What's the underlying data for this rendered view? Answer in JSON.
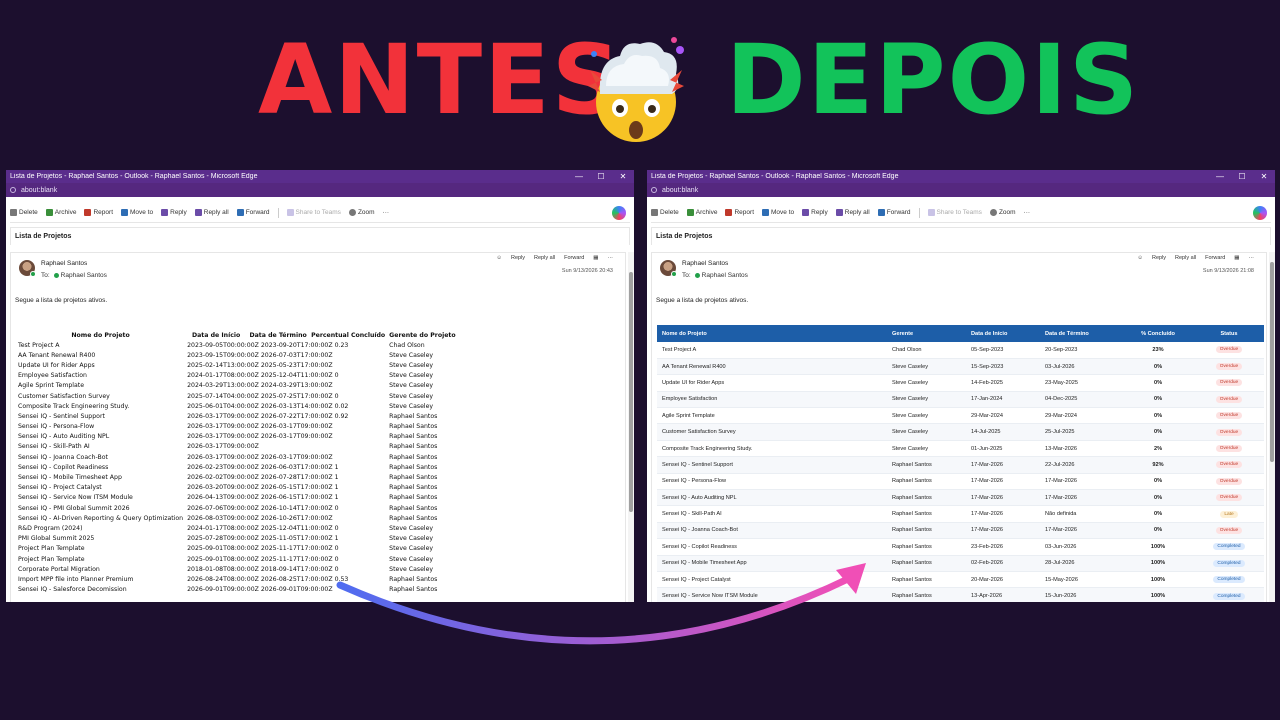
{
  "headline": {
    "before": "ANTES",
    "after": "DEPOIS"
  },
  "colors": {
    "before": "#f2323a",
    "after": "#12c35a",
    "background": "#1c0f2e",
    "titlebar": "#5a2d8c",
    "table_header": "#1d5ea8"
  },
  "window": {
    "title": "Lista de Projetos - Raphael Santos - Outlook - Raphael Santos - Microsoft Edge",
    "address": "about:blank",
    "toolbar": [
      "Delete",
      "Archive",
      "Report",
      "Move to",
      "Reply",
      "Reply all",
      "Forward",
      "Share to Teams",
      "Zoom"
    ],
    "subject": "Lista de Projetos"
  },
  "message": {
    "sender": "Raphael Santos",
    "to_label": "To:",
    "to": "Raphael Santos",
    "actions": [
      "Reply",
      "Reply all",
      "Forward"
    ],
    "date_left": "Sun 9/13/2026 20:43",
    "date_right": "Sun 9/13/2026 21:08",
    "body": "Segue a lista de projetos ativos."
  },
  "old_table": {
    "headers": [
      "Nome do Projeto",
      "Data de Início",
      "Data de Término",
      "Percentual Concluído",
      "Gerente do Projeto"
    ],
    "rows": [
      [
        "Test Project A",
        "2023-09-05T00:00:00Z 2023-09-20T17:00:00Z 0.23",
        "Chad Olson"
      ],
      [
        "AA Tenant Renewal R400",
        "2023-09-15T09:00:00Z 2026-07-03T17:00:00Z",
        "Steve Caseley"
      ],
      [
        "Update UI for Rider Apps",
        "2025-02-14T13:00:00Z 2025-05-23T17:00:00Z",
        "Steve Caseley"
      ],
      [
        "Employee Satisfaction",
        "2024-01-17T08:00:00Z 2025-12-04T11:00:00Z 0",
        "Steve Caseley"
      ],
      [
        "Agile Sprint Template",
        "2024-03-29T13:00:00Z 2024-03-29T13:00:00Z",
        "Steve Caseley"
      ],
      [
        "Customer Satisfaction Survey",
        "2025-07-14T04:00:00Z 2025-07-25T17:00:00Z 0",
        "Steve Caseley"
      ],
      [
        "Composite Track Engineering Study.",
        "2025-06-01T04:00:00Z 2026-03-13T14:00:00Z 0.02",
        "Steve Caseley"
      ],
      [
        "Sensei IQ - Sentinel Support",
        "2026-03-17T09:00:00Z 2026-07-22T17:00:00Z 0.92",
        "Raphael Santos"
      ],
      [
        "Sensei IQ - Persona-Flow",
        "2026-03-17T09:00:00Z 2026-03-17T09:00:00Z",
        "Raphael Santos"
      ],
      [
        "Sensei IQ - Auto Auditing NPL",
        "2026-03-17T09:00:00Z 2026-03-17T09:00:00Z",
        "Raphael Santos"
      ],
      [
        "Sensei IQ - Skill-Path AI",
        "2026-03-17T09:00:00Z",
        "Raphael Santos"
      ],
      [
        "Sensei IQ - Joanna Coach-Bot",
        "2026-03-17T09:00:00Z 2026-03-17T09:00:00Z",
        "Raphael Santos"
      ],
      [
        "Sensei IQ - Copilot Readiness",
        "2026-02-23T09:00:00Z 2026-06-03T17:00:00Z 1",
        "Raphael Santos"
      ],
      [
        "Sensei IQ - Mobile Timesheet App",
        "2026-02-02T09:00:00Z 2026-07-28T17:00:00Z 1",
        "Raphael Santos"
      ],
      [
        "Sensei IQ - Project Catalyst",
        "2026-03-20T09:00:00Z 2026-05-15T17:00:00Z 1",
        "Raphael Santos"
      ],
      [
        "Sensei IQ - Service Now ITSM Module",
        "2026-04-13T09:00:00Z 2026-06-15T17:00:00Z 1",
        "Raphael Santos"
      ],
      [
        "Sensei IQ - PMI Global Summit 2026",
        "2026-07-06T09:00:00Z 2026-10-14T17:00:00Z 0",
        "Raphael Santos"
      ],
      [
        "Sensei IQ - AI-Driven Reporting & Query Optimization",
        "2026-08-03T09:00:00Z 2026-10-26T17:00:00Z",
        "Raphael Santos"
      ],
      [
        "R&D Program (2024)",
        "2024-01-17T08:00:00Z 2025-12-04T11:00:00Z 0",
        "Steve Caseley"
      ],
      [
        "PMI Global Summit 2025",
        "2025-07-28T09:00:00Z 2025-11-05T17:00:00Z 1",
        "Steve Caseley"
      ],
      [
        "Project Plan Template",
        "2025-09-01T08:00:00Z 2025-11-17T17:00:00Z 0",
        "Steve Caseley"
      ],
      [
        "Project Plan Template",
        "2025-09-01T08:00:00Z 2025-11-17T17:00:00Z 0",
        "Steve Caseley"
      ],
      [
        "Corporate Portal Migration",
        "2018-01-08T08:00:00Z 2018-09-14T17:00:00Z 0",
        "Steve Caseley"
      ],
      [
        "Import MPP file into Planner Premium",
        "2026-08-24T08:00:00Z 2026-08-25T17:00:00Z 0.53",
        "Raphael Santos"
      ],
      [
        "Sensei IQ - Salesforce Decomission",
        "2026-09-01T09:00:00Z 2026-09-01T09:00:00Z",
        "Raphael Santos"
      ]
    ]
  },
  "new_table": {
    "headers": [
      "Nome do Projeto",
      "Gerente",
      "Data de Início",
      "Data de Término",
      "% Concluído",
      "Status"
    ],
    "rows": [
      [
        "Test Project A",
        "Chad Olson",
        "05-Sep-2023",
        "20-Sep-2023",
        "23%",
        "Overdue"
      ],
      [
        "AA Tenant Renewal R400",
        "Steve Caseley",
        "15-Sep-2023",
        "03-Jul-2026",
        "0%",
        "Overdue"
      ],
      [
        "Update UI for Rider Apps",
        "Steve Caseley",
        "14-Feb-2025",
        "23-May-2025",
        "0%",
        "Overdue"
      ],
      [
        "Employee Satisfaction",
        "Steve Caseley",
        "17-Jan-2024",
        "04-Dec-2025",
        "0%",
        "Overdue"
      ],
      [
        "Agile Sprint Template",
        "Steve Caseley",
        "29-Mar-2024",
        "29-Mar-2024",
        "0%",
        "Overdue"
      ],
      [
        "Customer Satisfaction Survey",
        "Steve Caseley",
        "14-Jul-2025",
        "25-Jul-2025",
        "0%",
        "Overdue"
      ],
      [
        "Composite Track Engineering Study.",
        "Steve Caseley",
        "01-Jun-2025",
        "13-Mar-2026",
        "2%",
        "Overdue"
      ],
      [
        "Sensei IQ - Sentinel Support",
        "Raphael Santos",
        "17-Mar-2026",
        "22-Jul-2026",
        "92%",
        "Overdue"
      ],
      [
        "Sensei IQ - Persona-Flow",
        "Raphael Santos",
        "17-Mar-2026",
        "17-Mar-2026",
        "0%",
        "Overdue"
      ],
      [
        "Sensei IQ - Auto Auditing NPL",
        "Raphael Santos",
        "17-Mar-2026",
        "17-Mar-2026",
        "0%",
        "Overdue"
      ],
      [
        "Sensei IQ - Skill-Path AI",
        "Raphael Santos",
        "17-Mar-2026",
        "Não definida",
        "0%",
        "Late"
      ],
      [
        "Sensei IQ - Joanna Coach-Bot",
        "Raphael Santos",
        "17-Mar-2026",
        "17-Mar-2026",
        "0%",
        "Overdue"
      ],
      [
        "Sensei IQ - Copilot Readiness",
        "Raphael Santos",
        "23-Feb-2026",
        "03-Jun-2026",
        "100%",
        "Completed"
      ],
      [
        "Sensei IQ - Mobile Timesheet App",
        "Raphael Santos",
        "02-Feb-2026",
        "28-Jul-2026",
        "100%",
        "Completed"
      ],
      [
        "Sensei IQ - Project Catalyst",
        "Raphael Santos",
        "20-Mar-2026",
        "15-May-2026",
        "100%",
        "Completed"
      ],
      [
        "Sensei IQ - Service Now ITSM Module",
        "Raphael Santos",
        "13-Apr-2026",
        "15-Jun-2026",
        "100%",
        "Completed"
      ]
    ]
  }
}
